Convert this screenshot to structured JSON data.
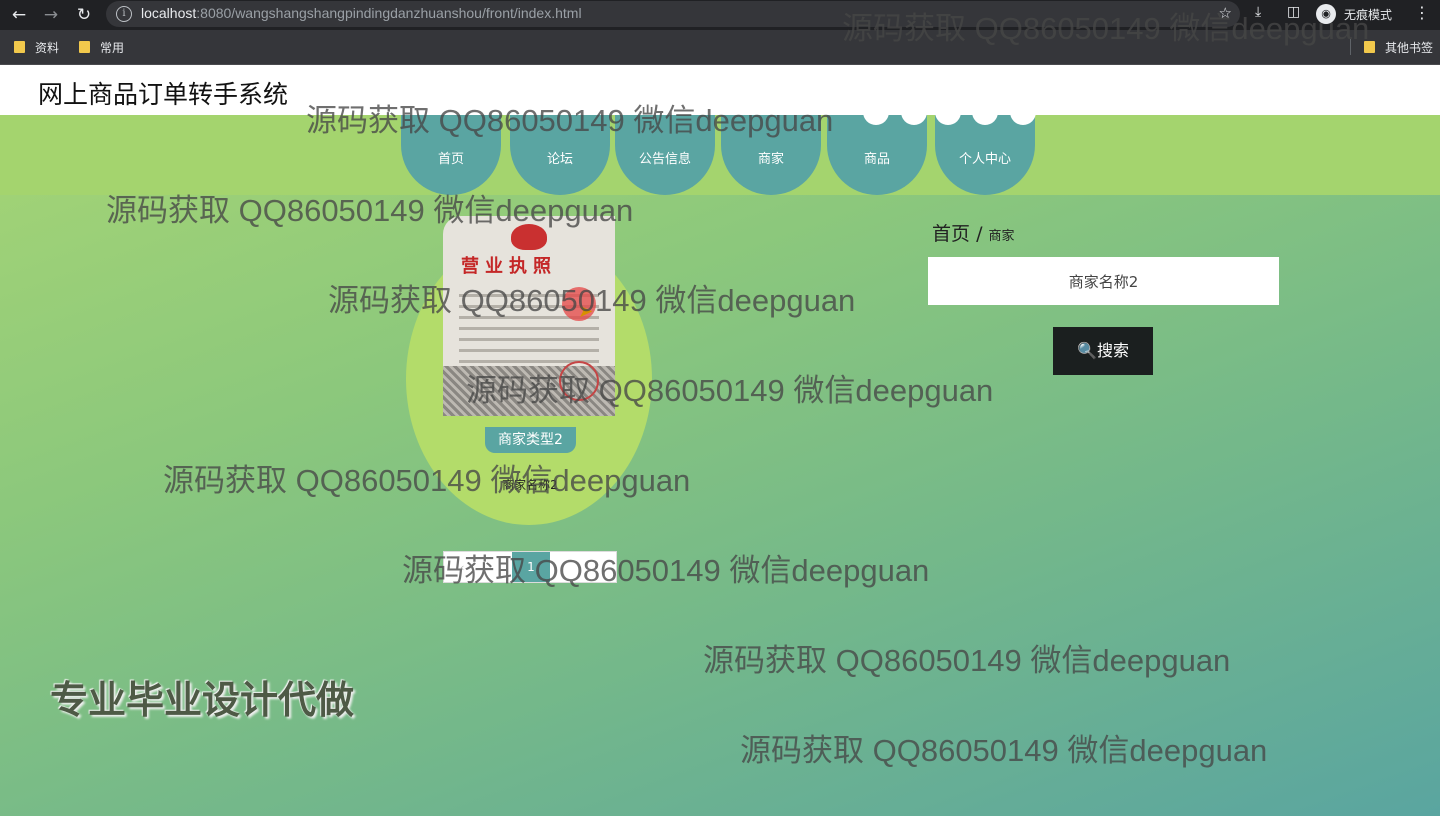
{
  "browser": {
    "url_host": "localhost",
    "url_rest": ":8080/wangshangshangpindingdanzhuanshou/front/index.html",
    "incognito_label": "无痕模式",
    "bookmarks": [
      "资料",
      "常用"
    ],
    "other_bookmarks": "其他书签"
  },
  "site": {
    "title": "网上商品订单转手系统",
    "menu": [
      "首页",
      "论坛",
      "公告信息",
      "商家",
      "商品",
      "个人中心"
    ]
  },
  "shop_card": {
    "license_title": "营业执照",
    "type": "商家类型2",
    "name": "商家名称2"
  },
  "pager": {
    "current": "1"
  },
  "breadcrumb": {
    "home": "首页",
    "separator": "/",
    "current": "商家"
  },
  "search": {
    "value": "商家名称2",
    "button_label": "搜索",
    "icon": "search-icon"
  },
  "promo": "专业毕业设计代做",
  "watermark": "源码获取 QQ86050149 微信deepguan",
  "colors": {
    "teal": "#5aa5a2",
    "green": "#a4d46e",
    "button": "#1b1f1f"
  }
}
